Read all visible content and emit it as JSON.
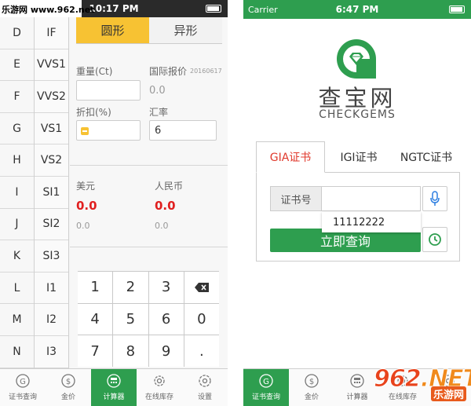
{
  "watermark": {
    "site": "乐游网 www.962.net",
    "logo_number": "962",
    "logo_suffix": ".NET",
    "logo_cn": "乐游网"
  },
  "left": {
    "status_time": "10:17 PM",
    "color_grades": [
      "D",
      "E",
      "F",
      "G",
      "H",
      "I",
      "J",
      "K",
      "L",
      "M",
      "N"
    ],
    "clarity_grades": [
      "IF",
      "VVS1",
      "VVS2",
      "VS1",
      "VS2",
      "SI1",
      "SI2",
      "SI3",
      "I1",
      "I2",
      "I3"
    ],
    "shape_tabs": [
      "圆形",
      "异形"
    ],
    "weight_label": "重量(Ct)",
    "intl_price_label": "国际报价",
    "intl_price_date": "20160617",
    "intl_price_value": "0.0",
    "discount_label": "折扣(%)",
    "rate_label": "汇率",
    "rate_value": "6",
    "usd_label": "美元",
    "usd_price": "0.0",
    "usd_sub": "0.0",
    "rmb_label": "人民币",
    "rmb_price": "0.0",
    "rmb_sub": "0.0",
    "keypad": [
      "1",
      "2",
      "3",
      "del",
      "4",
      "5",
      "6",
      "0",
      "7",
      "8",
      "9",
      "."
    ],
    "tabs": [
      {
        "label": "证书查询",
        "icon": "certificate-icon"
      },
      {
        "label": "金价",
        "icon": "dollar-icon"
      },
      {
        "label": "计算器",
        "icon": "calculator-icon"
      },
      {
        "label": "在线库存",
        "icon": "gear-icon"
      },
      {
        "label": "设置",
        "icon": "settings-icon"
      }
    ],
    "active_tab": 2
  },
  "right": {
    "carrier": "Carrier",
    "status_time": "6:47 PM",
    "brand_cn": "查宝网",
    "brand_en": "CHECKGEMS",
    "cert_tabs": [
      "GIA证书",
      "IGI证书",
      "NGTC证书"
    ],
    "cert_label": "证书号",
    "cert_input_value": "",
    "suggestion": "11112222",
    "query_button": "立即查询",
    "tabs": [
      {
        "label": "证书查询",
        "icon": "certificate-icon"
      },
      {
        "label": "金价",
        "icon": "dollar-icon"
      },
      {
        "label": "计算器",
        "icon": "calculator-icon"
      },
      {
        "label": "在线库存",
        "icon": "gear-icon"
      },
      {
        "label": "设置",
        "icon": "settings-icon"
      }
    ],
    "active_tab": 0
  },
  "colors": {
    "accent_green": "#2e9e4f",
    "accent_yellow": "#f7c233",
    "price_red": "#e02020",
    "tab_red": "#e03a2d"
  }
}
